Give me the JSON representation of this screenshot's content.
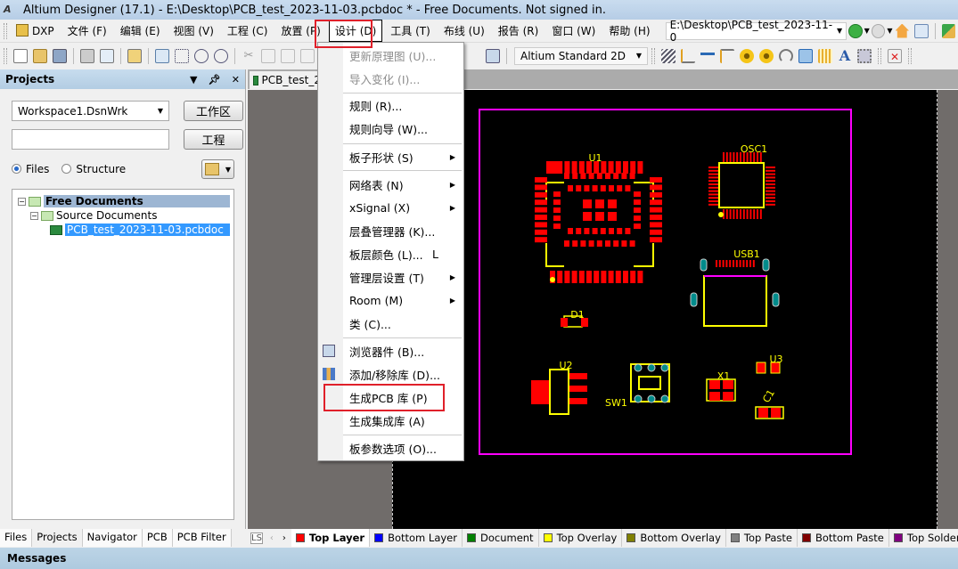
{
  "window": {
    "title": "Altium Designer (17.1) - E:\\Desktop\\PCB_test_2023-11-03.pcbdoc * - Free Documents. Not signed in."
  },
  "menubar": {
    "items": [
      {
        "label": "DXP"
      },
      {
        "label": "文件 (F)"
      },
      {
        "label": "编辑 (E)"
      },
      {
        "label": "视图 (V)"
      },
      {
        "label": "工程 (C)"
      },
      {
        "label": "放置 (P)"
      },
      {
        "label": "设计 (D)",
        "active": true
      },
      {
        "label": "工具 (T)"
      },
      {
        "label": "布线 (U)"
      },
      {
        "label": "报告 (R)"
      },
      {
        "label": "窗口 (W)"
      },
      {
        "label": "帮助 (H)"
      }
    ],
    "path": "E:\\Desktop\\PCB_test_2023-11-0"
  },
  "toolbar": {
    "view_mode": "Altium Standard 2D"
  },
  "projects_panel": {
    "title": "Projects",
    "workspace_value": "Workspace1.DsnWrk",
    "workspace_button": "工作区",
    "project_value": "",
    "project_button": "工程",
    "radio_files": "Files",
    "radio_structure": "Structure",
    "selected_radio": "Files",
    "tree": [
      {
        "label": "Free Documents",
        "level": 0,
        "expanded": true
      },
      {
        "label": "Source Documents",
        "level": 1,
        "expanded": true
      },
      {
        "label": "PCB_test_2023-11-03.pcbdoc",
        "level": 2,
        "selected": true
      }
    ],
    "tabs": [
      "Files",
      "Projects",
      "Navigator",
      "PCB",
      "PCB Filter"
    ],
    "active_tab": "Projects"
  },
  "document": {
    "tab_label": "PCB_test_2",
    "components": [
      "U1",
      "OSC1",
      "USB1",
      "D1",
      "U2",
      "SW1",
      "X1",
      "U3",
      "C1"
    ]
  },
  "design_menu": {
    "items": [
      {
        "label": "更新原理图 (U)...",
        "disabled": true
      },
      {
        "label": "导入变化 (I)...",
        "disabled": true
      },
      {
        "label": "规则 (R)..."
      },
      {
        "label": "规则向导 (W)..."
      },
      {
        "label": "板子形状 (S)",
        "submenu": true
      },
      {
        "label": "网络表 (N)",
        "submenu": true
      },
      {
        "label": "xSignal (X)",
        "submenu": true
      },
      {
        "label": "层叠管理器 (K)..."
      },
      {
        "label": "板层颜色 (L)...",
        "shortcut": "L"
      },
      {
        "label": "管理层设置 (T)",
        "submenu": true
      },
      {
        "label": "Room (M)",
        "submenu": true
      },
      {
        "label": "类 (C)..."
      },
      {
        "label": "浏览器件 (B)...",
        "icon": "browse-components-icon"
      },
      {
        "label": "添加/移除库 (D)...",
        "icon": "library-icon"
      },
      {
        "label": "生成PCB 库 (P)",
        "highlighted": true
      },
      {
        "label": "生成集成库 (A)"
      },
      {
        "label": "板参数选项 (O)..."
      }
    ]
  },
  "layer_bar": {
    "ls_label": "LS",
    "current_color": "#ff0000",
    "layers": [
      {
        "name": "Top Layer",
        "color": "#ff0000",
        "active": true
      },
      {
        "name": "Bottom Layer",
        "color": "#0000ff"
      },
      {
        "name": "Document",
        "color": "#008000"
      },
      {
        "name": "Top Overlay",
        "color": "#ffff00"
      },
      {
        "name": "Bottom Overlay",
        "color": "#808000"
      },
      {
        "name": "Top Paste",
        "color": "#808080"
      },
      {
        "name": "Bottom Paste",
        "color": "#800000"
      },
      {
        "name": "Top Solder",
        "color": "#800080"
      }
    ]
  },
  "messages_panel": {
    "title": "Messages"
  }
}
